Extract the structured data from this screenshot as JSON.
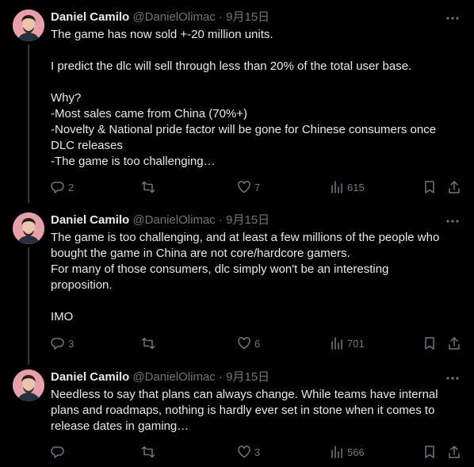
{
  "tweets": [
    {
      "author": "Daniel Camilo",
      "handle": "@DanielOlimac",
      "sep": "·",
      "date": "9月15日",
      "lines": [
        "The game has now sold +-20 million units.",
        "",
        "I predict the dlc will sell through less than 20% of the total user base.",
        "",
        "Why?",
        "-Most sales came from China (70%+)",
        "-Novelty & National pride factor will be gone for Chinese consumers once",
        "DLC releases",
        "-The game is too challenging…"
      ],
      "replies": "2",
      "reposts": "",
      "likes": "7",
      "views": "615"
    },
    {
      "author": "Daniel Camilo",
      "handle": "@DanielOlimac",
      "sep": "·",
      "date": "9月15日",
      "lines": [
        "The game is too challenging, and at least a few millions of the people who",
        "bought the game in China are not core/hardcore gamers.",
        "For many of those consumers, dlc simply won't be an interesting",
        "proposition.",
        "",
        "IMO"
      ],
      "replies": "3",
      "reposts": "",
      "likes": "6",
      "views": "701"
    },
    {
      "author": "Daniel Camilo",
      "handle": "@DanielOlimac",
      "sep": "·",
      "date": "9月15日",
      "lines": [
        "Needless to say that plans can always change. While teams have internal",
        "plans and roadmaps, nothing is hardly ever set in stone when it comes to",
        "release dates in gaming…"
      ],
      "replies": "",
      "reposts": "",
      "likes": "3",
      "views": "566"
    }
  ],
  "icons": {
    "reply": "reply-icon",
    "repost": "repost-icon",
    "like": "like-icon",
    "views": "views-icon",
    "bookmark": "bookmark-icon",
    "share": "share-icon",
    "more": "more-icon"
  },
  "colors": {
    "background": "#000000",
    "text": "#e7e9ea",
    "muted": "#71767b",
    "thread_line": "#333639"
  }
}
